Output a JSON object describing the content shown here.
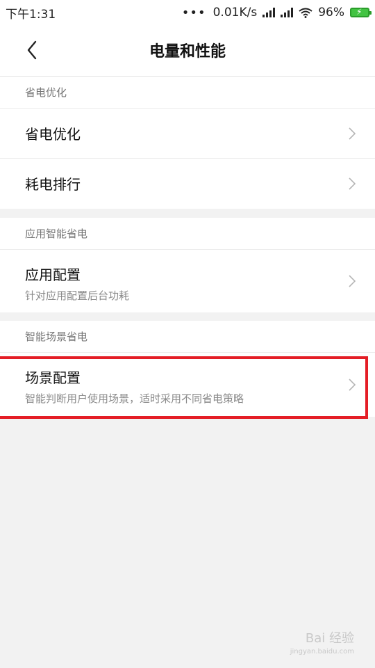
{
  "status": {
    "time": "下午1:31",
    "dots": "•••",
    "speed": "0.01K/s",
    "battery": "96%"
  },
  "header": {
    "title": "电量和性能",
    "back_icon": "back-chevron-icon"
  },
  "sections": [
    {
      "label": "省电优化",
      "items": [
        {
          "title": "省电优化"
        },
        {
          "title": "耗电排行"
        }
      ]
    },
    {
      "label": "应用智能省电",
      "items": [
        {
          "title": "应用配置",
          "subtitle": "针对应用配置后台功耗"
        }
      ]
    },
    {
      "label": "智能场景省电",
      "items": [
        {
          "title": "场景配置",
          "subtitle": "智能判断用户使用场景，适时采用不同省电策略"
        }
      ]
    }
  ],
  "watermark": {
    "text": "Bai 经验",
    "sub": "jingyan.baidu.com"
  },
  "colors": {
    "highlight": "#e41e26",
    "battery": "#42c342"
  }
}
